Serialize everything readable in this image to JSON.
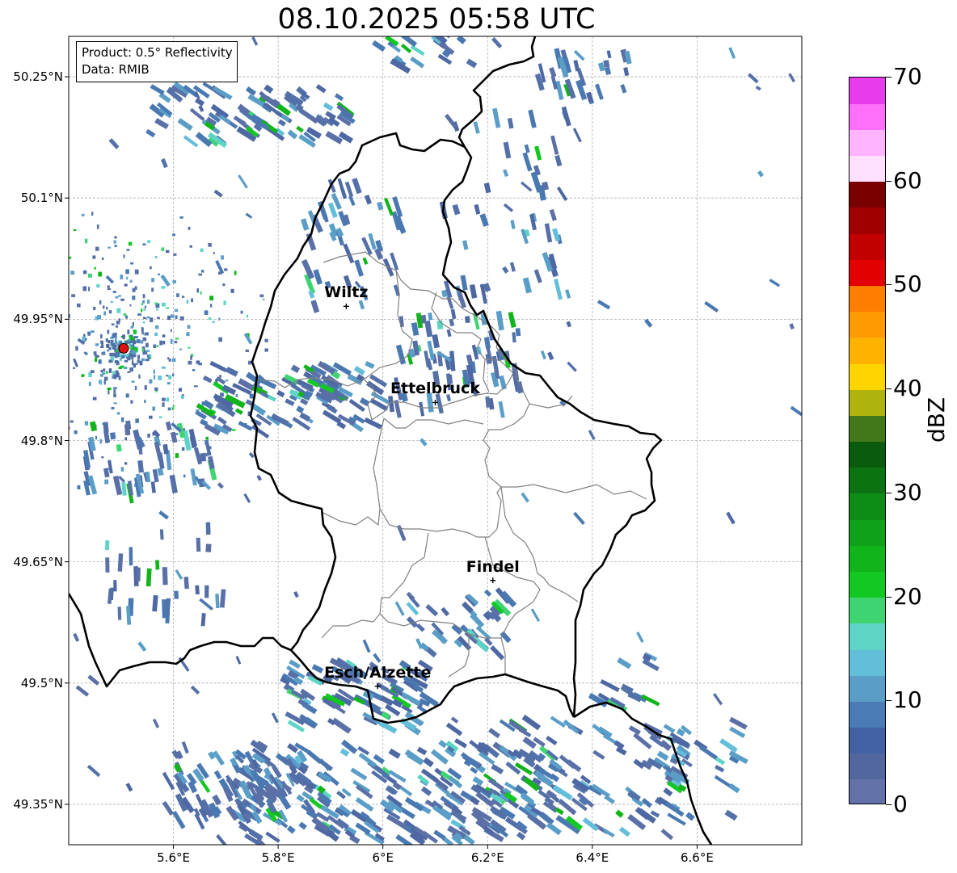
{
  "title": "08.10.2025 05:58 UTC",
  "info": {
    "product": "Product: 0.5° Reflectivity",
    "data": "Data: RMIB"
  },
  "map": {
    "lon_range": [
      5.4,
      6.8
    ],
    "lat_range": [
      49.3,
      50.3
    ],
    "lon_ticks": [
      {
        "value": 5.6,
        "label": "5.6°E"
      },
      {
        "value": 5.8,
        "label": "5.8°E"
      },
      {
        "value": 6.0,
        "label": "6°E"
      },
      {
        "value": 6.2,
        "label": "6.2°E"
      },
      {
        "value": 6.4,
        "label": "6.4°E"
      },
      {
        "value": 6.6,
        "label": "6.6°E"
      }
    ],
    "lat_ticks": [
      {
        "value": 50.25,
        "label": "50.25°N"
      },
      {
        "value": 50.1,
        "label": "50.1°N"
      },
      {
        "value": 49.95,
        "label": "49.95°N"
      },
      {
        "value": 49.8,
        "label": "49.8°N"
      },
      {
        "value": 49.65,
        "label": "49.65°N"
      },
      {
        "value": 49.5,
        "label": "49.5°N"
      },
      {
        "value": 49.35,
        "label": "49.35°N"
      }
    ],
    "cities": [
      {
        "name": "Wiltz",
        "lon": 5.93,
        "lat": 49.966
      },
      {
        "name": "Ettelbruck",
        "lon": 6.1,
        "lat": 49.847
      },
      {
        "name": "Findel",
        "lon": 6.21,
        "lat": 49.627
      },
      {
        "name": "Esch/Alzette",
        "lon": 5.99,
        "lat": 49.496
      }
    ],
    "radar_site": {
      "lon": 5.505,
      "lat": 49.914,
      "color": "#dd1111"
    }
  },
  "colorbar": {
    "label": "dBZ",
    "min": 0,
    "max": 70,
    "ticks": [
      {
        "value": 0,
        "label": "0"
      },
      {
        "value": 10,
        "label": "10"
      },
      {
        "value": 20,
        "label": "20"
      },
      {
        "value": 30,
        "label": "30"
      },
      {
        "value": 40,
        "label": "40"
      },
      {
        "value": 50,
        "label": "50"
      },
      {
        "value": 60,
        "label": "60"
      },
      {
        "value": 70,
        "label": "70"
      }
    ],
    "colors": [
      "#6272a8",
      "#53679f",
      "#4360a3",
      "#4b7bb4",
      "#5a9ec7",
      "#63bed9",
      "#5dd4c5",
      "#3fd472",
      "#13c823",
      "#12b41c",
      "#10a11a",
      "#0e8c16",
      "#0b7312",
      "#0a5b0e",
      "#42771a",
      "#afb30e",
      "#ffd500",
      "#ffb300",
      "#ff9a00",
      "#ff7d00",
      "#e30000",
      "#c20000",
      "#a00000",
      "#7a0000",
      "#ffe0ff",
      "#ffb4ff",
      "#ff6ff9",
      "#e83bec"
    ]
  }
}
